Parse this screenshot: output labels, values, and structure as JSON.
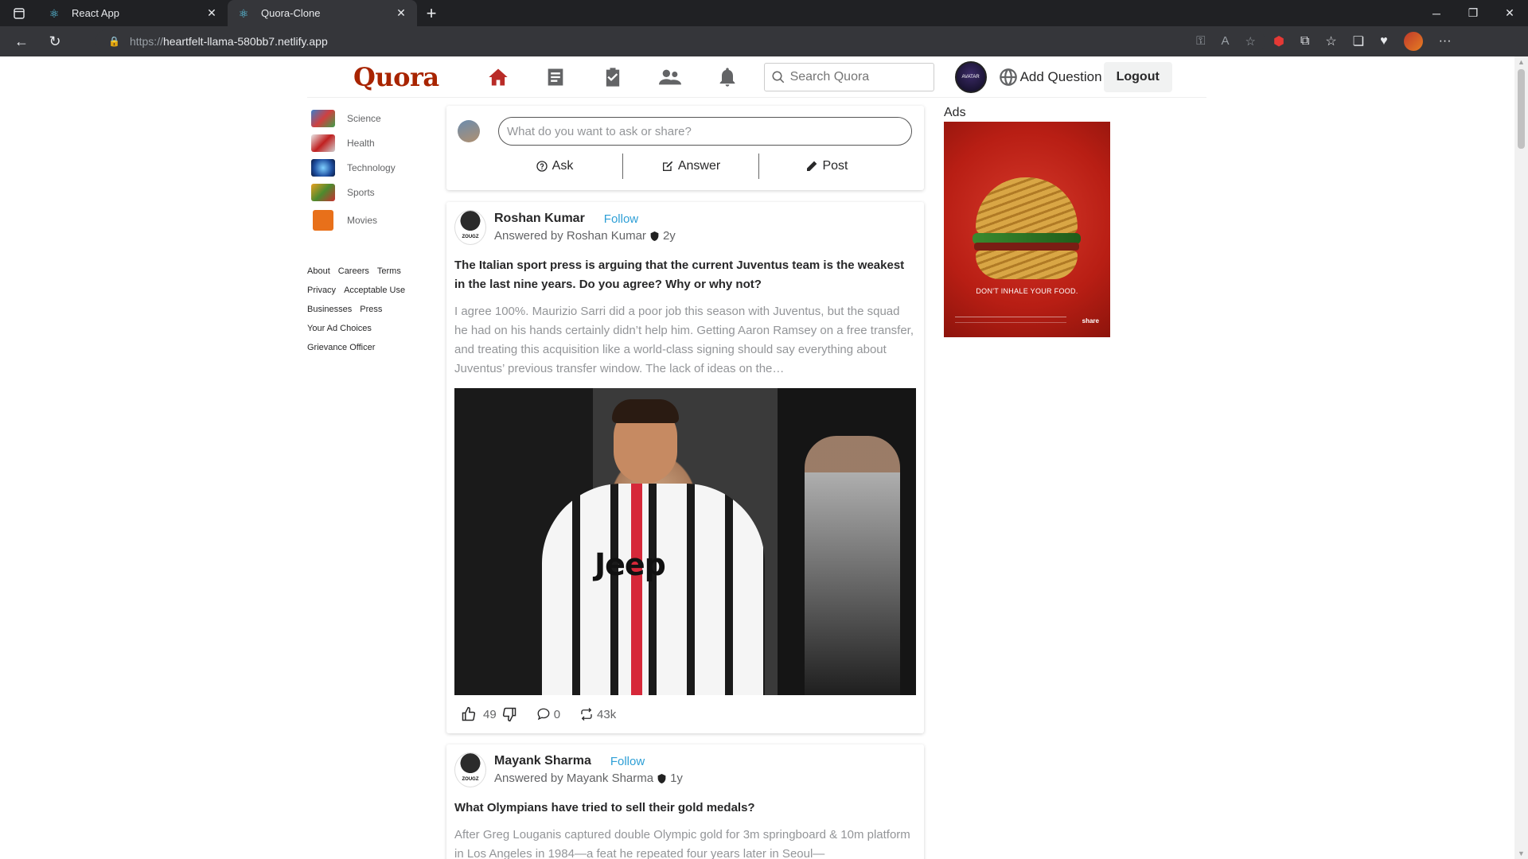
{
  "browser": {
    "tabs": [
      {
        "title": "React App",
        "active": false
      },
      {
        "title": "Quora-Clone",
        "active": true
      }
    ],
    "url_protocol": "https://",
    "url_host": "heartfelt-llama-580bb7.netlify.app"
  },
  "header": {
    "logo": "Quora",
    "search_placeholder": "Search Quora",
    "avatar_text": "AVATAR",
    "add_question": "Add Question",
    "logout": "Logout",
    "active_color": "#b92b27"
  },
  "sidebar": {
    "topics": [
      {
        "label": "Science",
        "color": "#3d7dc9"
      },
      {
        "label": "Health",
        "color": "#c9c9c9"
      },
      {
        "label": "Technology",
        "color": "#1f4fa0"
      },
      {
        "label": "Sports",
        "color": "#4d8a2f"
      },
      {
        "label": "Movies",
        "color": "#e8701a"
      }
    ],
    "links": [
      [
        "About",
        "Careers",
        "Terms"
      ],
      [
        "Privacy",
        "Acceptable Use"
      ],
      [
        "Businesses",
        "Press"
      ],
      [
        "Your Ad Choices"
      ],
      [
        "Grievance Officer"
      ]
    ]
  },
  "askbox": {
    "placeholder": "What do you want to ask or share?",
    "ask": "Ask",
    "answer": "Answer",
    "post": "Post"
  },
  "posts": [
    {
      "author": "Roshan Kumar",
      "follow": "Follow",
      "answered_by": "Answered by Roshan Kumar",
      "age": "2y",
      "avatar_text": "ZOUGZ",
      "question": "The Italian sport press is arguing that the current Juventus team is the weakest in the last nine years. Do you agree? Why or why not?",
      "body": "I agree 100%. Maurizio Sarri did a poor job this season with Juventus, but the squad he had on his hands certainly didn’t help him. Getting Aaron Ramsey on a free transfer, and treating this acquisition like a world-class signing should say everything about Juventus’ previous transfer window. The lack of ideas on the…",
      "image_brand": "Jeep",
      "upvotes": "49",
      "comments": "0",
      "shares": "43k"
    },
    {
      "author": "Mayank Sharma",
      "follow": "Follow",
      "answered_by": "Answered by Mayank Sharma",
      "age": "1y",
      "avatar_text": "ZOUGZ",
      "question": "What Olympians have tried to sell their gold medals?",
      "body": "After Greg Louganis captured double Olympic gold for 3m springboard & 10m platform in Los Angeles in 1984—a feat he repeated four years later in Seoul—"
    }
  ],
  "ads": {
    "label": "Ads",
    "tagline": "DON'T INHALE YOUR FOOD.",
    "brand": "share"
  }
}
